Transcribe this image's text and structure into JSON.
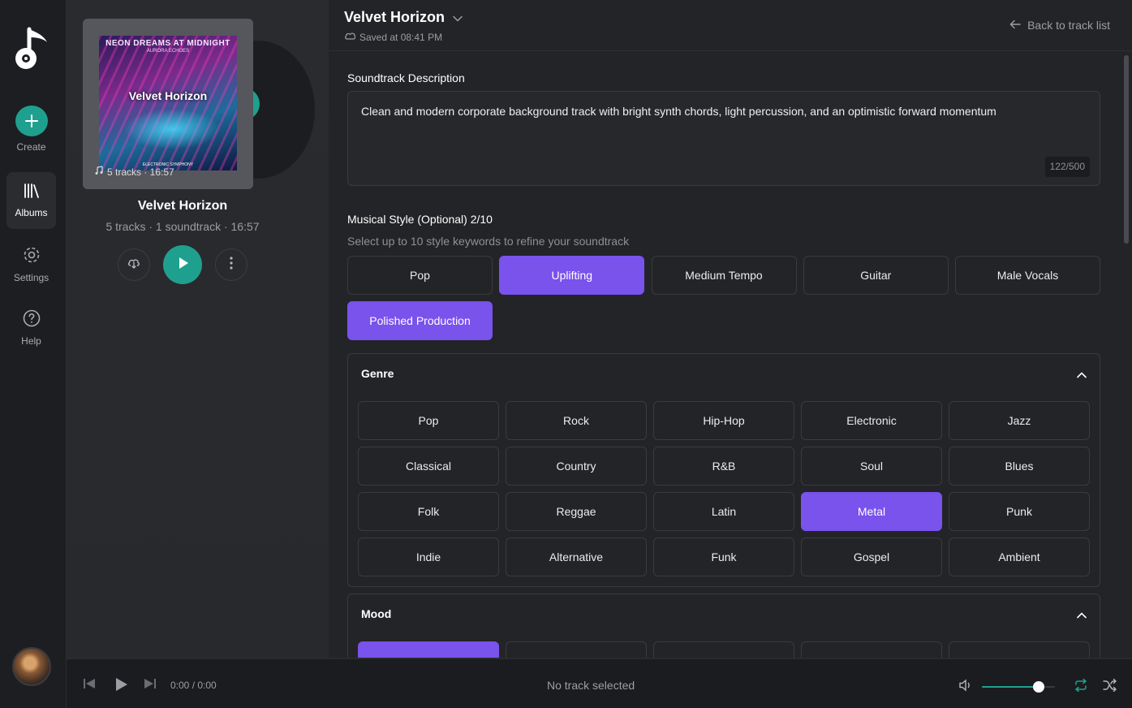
{
  "rail": {
    "create": "Create",
    "albums": "Albums",
    "settings": "Settings",
    "help": "Help"
  },
  "album": {
    "cover_top": "NEON DREAMS AT MIDNIGHT",
    "cover_sub": "AURORA ECHOES",
    "cover_title": "Velvet Horizon",
    "cover_bottom": "ELECTRONIC SYMPHONY",
    "cover_meta": "5 tracks · 16:57",
    "title": "Velvet Horizon",
    "meta": "5 tracks · 1 soundtrack · 16:57"
  },
  "header": {
    "title": "Velvet Horizon",
    "saved": "Saved at 08:41 PM",
    "back": "Back to track list"
  },
  "description": {
    "label": "Soundtrack Description",
    "text": "Clean and modern corporate background track with bright synth chords, light percussion, and an optimistic forward momentum",
    "counter": "122/500"
  },
  "style": {
    "label": "Musical Style (Optional) 2/10",
    "helper": "Select up to 10 style keywords to refine your soundtrack",
    "chips": [
      {
        "label": "Pop",
        "selected": false
      },
      {
        "label": "Uplifting",
        "selected": true
      },
      {
        "label": "Medium Tempo",
        "selected": false
      },
      {
        "label": "Guitar",
        "selected": false
      },
      {
        "label": "Male Vocals",
        "selected": false
      },
      {
        "label": "Polished Production",
        "selected": true
      }
    ]
  },
  "genre": {
    "label": "Genre",
    "chips": [
      {
        "label": "Pop",
        "selected": false
      },
      {
        "label": "Rock",
        "selected": false
      },
      {
        "label": "Hip-Hop",
        "selected": false
      },
      {
        "label": "Electronic",
        "selected": false
      },
      {
        "label": "Jazz",
        "selected": false
      },
      {
        "label": "Classical",
        "selected": false
      },
      {
        "label": "Country",
        "selected": false
      },
      {
        "label": "R&B",
        "selected": false
      },
      {
        "label": "Soul",
        "selected": false
      },
      {
        "label": "Blues",
        "selected": false
      },
      {
        "label": "Folk",
        "selected": false
      },
      {
        "label": "Reggae",
        "selected": false
      },
      {
        "label": "Latin",
        "selected": false
      },
      {
        "label": "Metal",
        "selected": true
      },
      {
        "label": "Punk",
        "selected": false
      },
      {
        "label": "Indie",
        "selected": false
      },
      {
        "label": "Alternative",
        "selected": false
      },
      {
        "label": "Funk",
        "selected": false
      },
      {
        "label": "Gospel",
        "selected": false
      },
      {
        "label": "Ambient",
        "selected": false
      }
    ]
  },
  "mood": {
    "label": "Mood"
  },
  "player": {
    "time": "0:00 / 0:00",
    "now_playing": "No track selected",
    "volume": 0.78
  },
  "colors": {
    "accent": "#7a52ec",
    "teal": "#1fa08f",
    "background": "#232427"
  },
  "icons": {
    "logo": "music-note-disc-icon",
    "create": "plus-icon",
    "albums": "library-icon",
    "settings": "gear-icon",
    "help": "question-icon",
    "download": "cloud-download-icon",
    "play": "play-icon",
    "more": "more-vertical-icon",
    "collapse": "chevron-up-icon"
  }
}
